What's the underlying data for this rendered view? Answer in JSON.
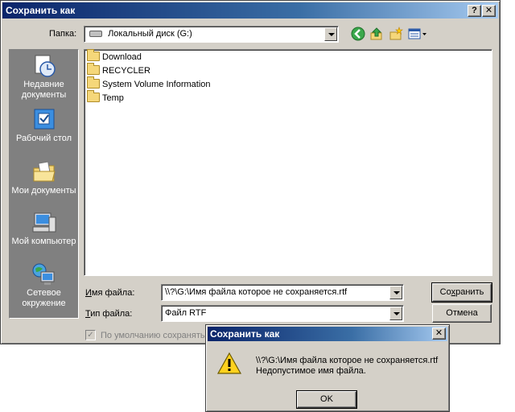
{
  "window": {
    "title": "Сохранить как",
    "help_btn": "?",
    "close_btn": "✕"
  },
  "lookin": {
    "label": "Папка:",
    "value": "Локальный диск (G:)"
  },
  "places": [
    {
      "label": "Недавние документы"
    },
    {
      "label": "Рабочий стол"
    },
    {
      "label": "Мои документы"
    },
    {
      "label": "Мой компьютер"
    },
    {
      "label": "Сетевое окружение"
    }
  ],
  "files": [
    "Download",
    "RECYCLER",
    "System Volume Information",
    "Temp"
  ],
  "filename": {
    "label_u": "И",
    "label_rest": "мя файла:",
    "value": "\\\\?\\G:\\Имя файла которое не сохраняется.rtf"
  },
  "filetype": {
    "label_u": "Т",
    "label_rest": "ип файла:",
    "value": "Файл RTF"
  },
  "buttons": {
    "save_u": "х",
    "save_pre": "Со",
    "save_post": "ранить",
    "cancel": "Отмена"
  },
  "checkbox": {
    "label": "По умолчанию сохранять"
  },
  "error": {
    "title": "Сохранить как",
    "close_btn": "✕",
    "line1": "\\\\?\\G:\\Имя файла которое не сохраняется.rtf",
    "line2": "Недопустимое имя файла.",
    "ok": "OK"
  },
  "colors": {
    "titlebar": "#0a246a",
    "face": "#d4d0c8",
    "places_bg": "#808080"
  }
}
